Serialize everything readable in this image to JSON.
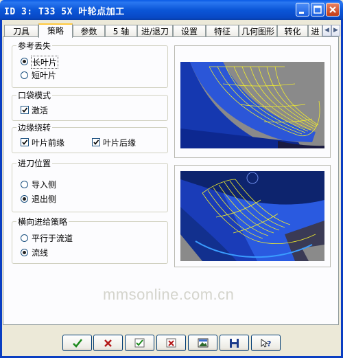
{
  "window": {
    "title": "ID 3: T33 5X 叶轮点加工"
  },
  "tabs": [
    {
      "label": "刀具"
    },
    {
      "label": "策略"
    },
    {
      "label": "参数"
    },
    {
      "label": "5 轴"
    },
    {
      "label": "进/退刀"
    },
    {
      "label": "设置"
    },
    {
      "label": "特征"
    },
    {
      "label": "几何图形"
    },
    {
      "label": "转化"
    },
    {
      "label": "进"
    }
  ],
  "active_tab": "策略",
  "groups": {
    "reference_loss": {
      "label": "参考丢失",
      "options": [
        {
          "label": "长叶片",
          "selected": true
        },
        {
          "label": "短叶片",
          "selected": false
        }
      ]
    },
    "pocket_mode": {
      "label": "口袋模式",
      "checkbox": {
        "label": "激活",
        "checked": true
      }
    },
    "edge_roll": {
      "label": "边缘绕转",
      "checkboxes": [
        {
          "label": "叶片前缘",
          "checked": true
        },
        {
          "label": "叶片后缘",
          "checked": true
        }
      ]
    },
    "approach_position": {
      "label": "进刀位置",
      "options": [
        {
          "label": "导入侧",
          "selected": false
        },
        {
          "label": "退出侧",
          "selected": true
        }
      ]
    },
    "stepover_strategy": {
      "label": "横向进给策略",
      "options": [
        {
          "label": "平行于流道",
          "selected": false
        },
        {
          "label": "流线",
          "selected": true
        }
      ]
    }
  },
  "watermark": "mmsonline.com.cn",
  "bottom_buttons": [
    {
      "icon": "ok-checkmark-icon",
      "color": "#1d8a1d"
    },
    {
      "icon": "cancel-x-icon",
      "color": "#b31818"
    },
    {
      "icon": "apply-check-icon",
      "color": "#1d8a1d"
    },
    {
      "icon": "reset-x-icon",
      "color": "#b31818"
    },
    {
      "icon": "preview-image-icon",
      "color": "#333333"
    },
    {
      "icon": "save-disk-icon",
      "color": "#1c3b8c"
    },
    {
      "icon": "help-question-icon",
      "color": "#1c3b8c"
    }
  ]
}
